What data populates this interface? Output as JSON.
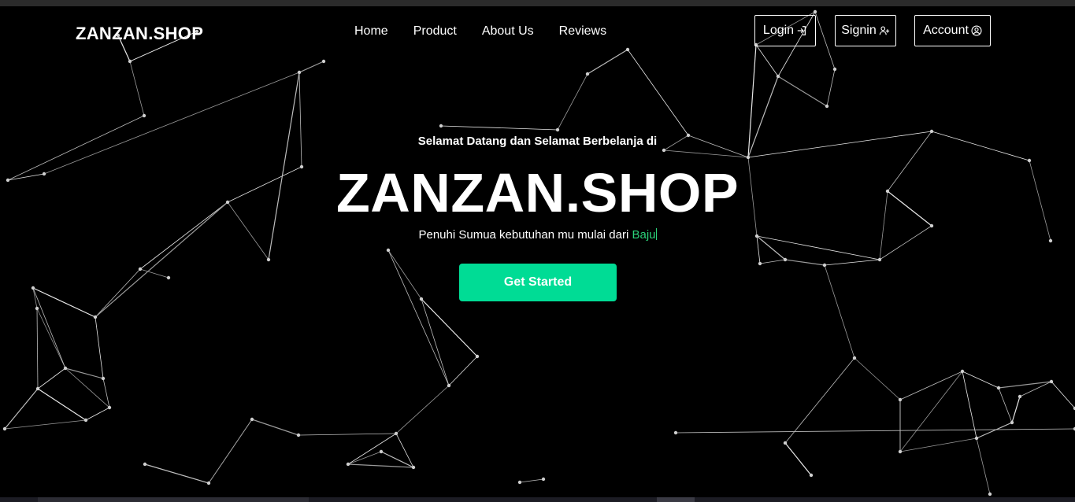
{
  "nav": {
    "brand": "ZANZAN.SHOP",
    "links": [
      "Home",
      "Product",
      "About Us",
      "Reviews"
    ],
    "login_label": "Login",
    "signin_label": "Signin",
    "account_label": "Account",
    "login_icon": "login-icon",
    "signin_icon": "person-add-icon",
    "account_icon": "user-circle-icon"
  },
  "hero": {
    "subtitle": "Selamat Datang dan Selamat Berbelanja di",
    "title": "ZANZAN.SHOP",
    "tagline_prefix": "Penuhi Sumua kebutuhan mu mulai dari ",
    "tagline_highlight": "Baju",
    "cta_label": "Get Started"
  },
  "colors": {
    "background": "#000000",
    "accent": "#00dc95",
    "highlight_text": "#2bd47a"
  }
}
